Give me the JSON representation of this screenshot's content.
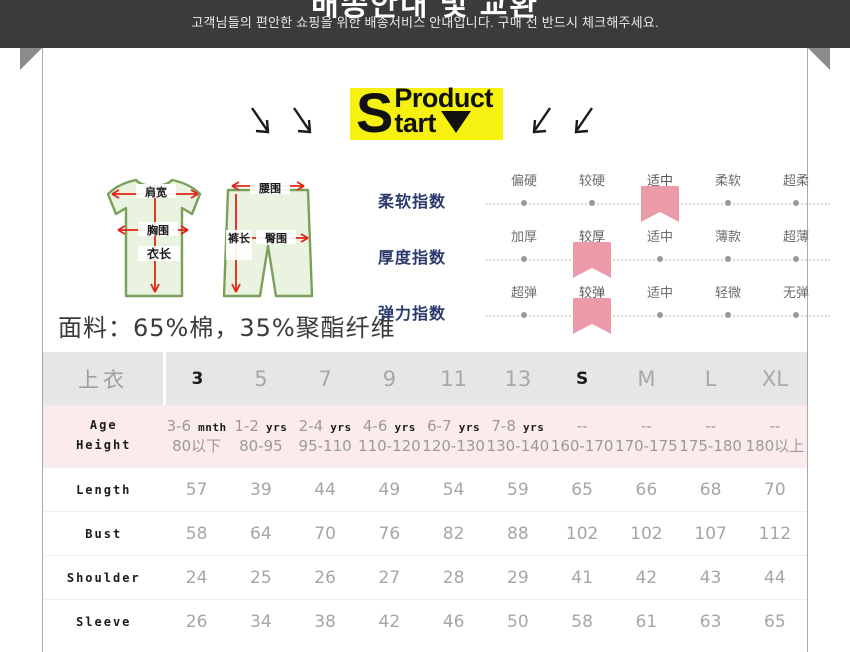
{
  "banner": {
    "title_partial": "배송안내 및 교환",
    "subtitle": "고객님들의 편안한 쇼핑을 위한 배송서비스 안내입니다. 구매 전 반드시 체크해주세요."
  },
  "logo": {
    "big_letter": "S",
    "word_top": "Product",
    "word_bottom": "tart",
    "triangle_icon": "triangle-down-icon",
    "highlight_color": "#f7f112"
  },
  "arrows": {
    "left": [
      "arrow-down-right-icon",
      "arrow-down-right-icon"
    ],
    "right": [
      "arrow-down-left-icon",
      "arrow-down-left-icon"
    ]
  },
  "garment": {
    "top_labels": [
      "肩宽",
      "胸围",
      "衣长"
    ],
    "bottom_labels": [
      "腰围",
      "臀围",
      "裤长"
    ],
    "fabric_text": "面料：65%棉，35%聚酯纤维",
    "outline_color": "#7ba05b",
    "fill_color": "#eaf3e0",
    "arrow_color": "#e02418"
  },
  "indexes": [
    {
      "label": "柔软指数",
      "scale": [
        "偏硬",
        "较硬",
        "适中",
        "柔软",
        "超柔"
      ],
      "marked": 2
    },
    {
      "label": "厚度指数",
      "scale": [
        "加厚",
        "较厚",
        "适中",
        "薄款",
        "超薄"
      ],
      "marked": 1
    },
    {
      "label": "弹力指数",
      "scale": [
        "超弹",
        "较弹",
        "适中",
        "轻微",
        "无弹"
      ],
      "marked": 1
    }
  ],
  "index_colors": {
    "label": "#2b3a6b",
    "ribbon": "#eb9aa8",
    "dot": "#9a9a9a"
  },
  "table": {
    "corner_label": "上衣",
    "sizes": [
      "3",
      "5",
      "7",
      "9",
      "11",
      "13",
      "S",
      "M",
      "L",
      "XL"
    ],
    "highlighted_sizes": [
      "3",
      "S"
    ],
    "age_label": "Age",
    "height_label": "Height",
    "ages": [
      "3-6",
      "1-2",
      "2-4",
      "4-6",
      "6-7",
      "7-8",
      "--",
      "--",
      "--",
      "--"
    ],
    "age_units": [
      "mnth",
      "yrs",
      "yrs",
      "yrs",
      "yrs",
      "yrs",
      "",
      "",
      "",
      ""
    ],
    "heights": [
      "80以下",
      "80-95",
      "95-110",
      "110-120",
      "120-130",
      "130-140",
      "160-170",
      "170-175",
      "175-180",
      "180以上"
    ],
    "rows": [
      {
        "label": "Length",
        "values": [
          "57",
          "39",
          "44",
          "49",
          "54",
          "59",
          "65",
          "66",
          "68",
          "70"
        ]
      },
      {
        "label": "Bust",
        "values": [
          "58",
          "64",
          "70",
          "76",
          "82",
          "88",
          "102",
          "102",
          "107",
          "112"
        ]
      },
      {
        "label": "Shoulder",
        "values": [
          "24",
          "25",
          "26",
          "27",
          "28",
          "29",
          "41",
          "42",
          "43",
          "44"
        ]
      },
      {
        "label": "Sleeve",
        "values": [
          "26",
          "34",
          "38",
          "42",
          "46",
          "50",
          "58",
          "61",
          "63",
          "65"
        ]
      }
    ]
  }
}
